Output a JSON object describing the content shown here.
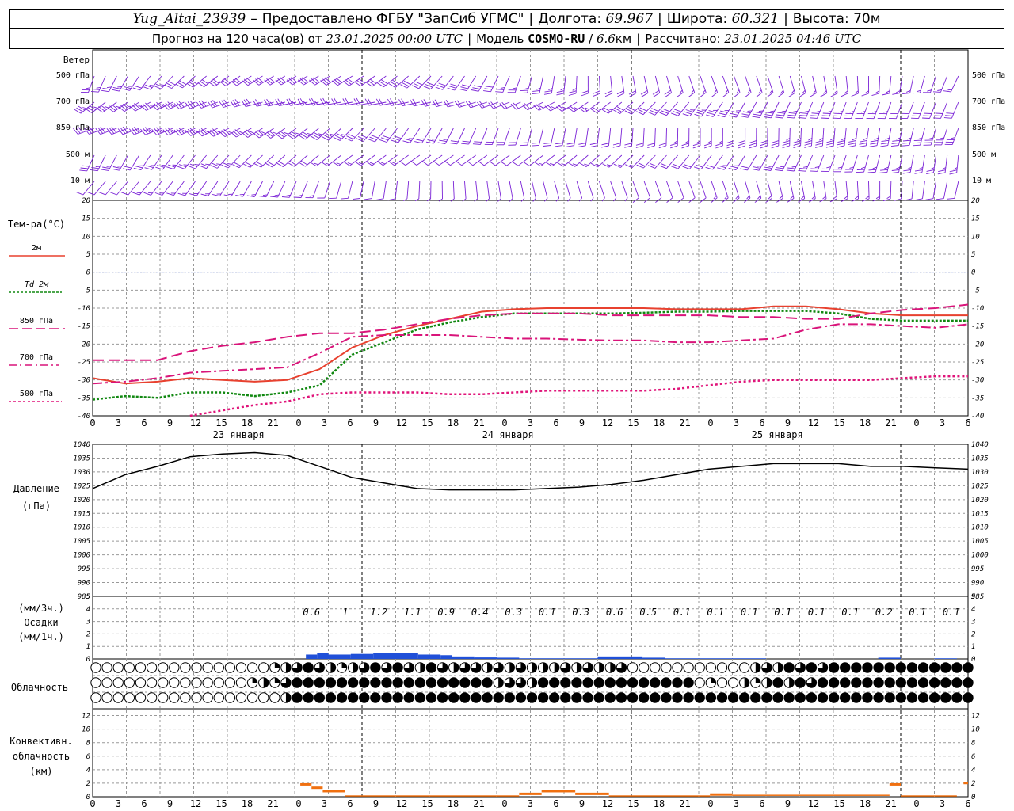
{
  "header": {
    "station": "Yug_Altai_23939",
    "dash": "–",
    "provided": "Предоставлено ФГБУ \"ЗапСиб УГМС\"",
    "lon_label": "Долгота:",
    "lon": "69.967",
    "lat_label": "Широта:",
    "lat": "60.321",
    "alt_label": "Высота:",
    "alt": "70м",
    "forecast_label": "Прогноз на 120 часа(ов) от",
    "forecast_start": "23.01.2025 00:00 UTC",
    "model_label": "Модель",
    "model": "COSMO-RU",
    "model_res_num": "6.6",
    "model_res_unit": "км",
    "calc_label": "Рассчитано:",
    "calc_time": "23.01.2025 04:46 UTC"
  },
  "labels": {
    "wind": "Ветер",
    "wind_levels": [
      "500 гПа",
      "700 гПа",
      "850 гПа",
      "500 м",
      "10  м"
    ],
    "temp_title": "Тем-ра(°С)",
    "temp_legend": [
      "2м",
      "Td  2м",
      "850 гПа",
      "700 гПа",
      "500 гПа"
    ],
    "pressure_title": "Давление",
    "pressure_unit": "(гПа)",
    "precip_unit1": "(мм/3ч.)",
    "precip_title": "Осадки",
    "precip_unit2": "(мм/1ч.)",
    "cloud_title": "Облачность",
    "conv_title1": "Конвективн.",
    "conv_title2": "облачность",
    "conv_unit": "(км)"
  },
  "chart_data": {
    "type": "line",
    "x_hours": [
      0,
      3,
      6,
      9,
      12,
      15,
      18,
      21,
      24,
      27,
      30,
      33,
      36,
      39,
      42,
      45,
      48,
      51,
      54,
      57,
      60,
      63,
      66,
      69,
      72,
      75,
      78,
      81,
      84,
      87,
      90,
      93,
      96,
      99,
      102,
      105,
      108,
      111,
      114,
      117,
      120
    ],
    "x_tick_labels": [
      "0",
      "3",
      "6",
      "9",
      "12",
      "15",
      "18",
      "21",
      "0",
      "3",
      "6",
      "9",
      "12",
      "15",
      "18",
      "21",
      "0",
      "3",
      "6",
      "9",
      "12",
      "15",
      "18",
      "21",
      "0",
      "3",
      "6",
      "9",
      "12",
      "15",
      "18",
      "21",
      "0",
      "3",
      "6"
    ],
    "date_labels": [
      {
        "text": "23 января",
        "hour": 13
      },
      {
        "text": "24 января",
        "hour": 37
      },
      {
        "text": "25 января",
        "hour": 61
      }
    ],
    "temperature": {
      "ylim": [
        -40,
        20
      ],
      "yticks": [
        20,
        15,
        10,
        5,
        0,
        -5,
        -10,
        -15,
        -20,
        -25,
        -30,
        -35,
        -40
      ],
      "series": [
        {
          "name": "2м",
          "color": "#e8412f",
          "values": [
            -29.5,
            -31,
            -30.5,
            -29.5,
            -30,
            -30.5,
            -30,
            -27,
            -21,
            -17.5,
            -15,
            -13,
            -11,
            -10.3,
            -10,
            -10,
            -10,
            -10,
            -10.3,
            -10.3,
            -10.3,
            -9.5,
            -9.5,
            -10.3,
            -11.5,
            -12,
            -12,
            -12
          ]
        },
        {
          "name": "Td  2м",
          "color": "#118811",
          "values": [
            -35.5,
            -34.5,
            -35,
            -33.5,
            -33.5,
            -34.5,
            -33.5,
            -31.5,
            -23,
            -19.5,
            -16,
            -14,
            -12.5,
            -11.5,
            -11.5,
            -11.5,
            -11.5,
            -11.3,
            -11,
            -11,
            -10.8,
            -10.8,
            -10.8,
            -11.5,
            -13,
            -13.5,
            -13.5,
            -13.5
          ]
        },
        {
          "name": "850 гПа",
          "color": "#d9147a",
          "values": [
            -24.5,
            -24.5,
            -24.5,
            -22,
            -20.5,
            -19.5,
            -18,
            -17,
            -17,
            -16,
            -14.5,
            -13,
            -12,
            -11.5,
            -11.5,
            -11.5,
            -12,
            -12,
            -12,
            -12,
            -12.5,
            -12.5,
            -13,
            -13,
            -11.5,
            -10.5,
            -10,
            -9
          ]
        },
        {
          "name": "700 гПа",
          "color": "#d9147a",
          "values": [
            -31,
            -30.5,
            -29.5,
            -28,
            -27.5,
            -27,
            -26.5,
            -22.5,
            -18,
            -17.5,
            -17.5,
            -17.5,
            -18,
            -18.5,
            -18.5,
            -18.8,
            -19,
            -19,
            -19.5,
            -19.5,
            -19,
            -18.5,
            -16,
            -14.5,
            -14.5,
            -15,
            -15.5,
            -14.5
          ]
        },
        {
          "name": "500 гПа",
          "color": "#e0147a",
          "values": [
            null,
            null,
            null,
            -40,
            -38.5,
            -37,
            -36,
            -34,
            -33.5,
            -33.5,
            -33.5,
            -34,
            -34,
            -33.5,
            -33,
            -33,
            -33,
            -33,
            -32.5,
            -31.5,
            -30.5,
            -30,
            -30,
            -30,
            -30,
            -29.5,
            -29,
            -29
          ]
        }
      ]
    },
    "pressure": {
      "ylim": [
        985,
        1040
      ],
      "yticks": [
        1040,
        1035,
        1030,
        1025,
        1020,
        1015,
        1010,
        1005,
        1000,
        995,
        990,
        985
      ],
      "values": [
        1024,
        1029,
        1032,
        1035.5,
        1036.5,
        1037,
        1036,
        1032,
        1028,
        1026,
        1024,
        1023.5,
        1023.5,
        1023.5,
        1024,
        1024.5,
        1025.5,
        1027,
        1029,
        1031,
        1032,
        1033,
        1033,
        1033,
        1032,
        1032,
        1031.5,
        1031
      ]
    },
    "precip_3h": {
      "ylim": [
        0,
        5
      ],
      "yticks": [
        5,
        4,
        3,
        2,
        1,
        0
      ],
      "labels": [
        {
          "hour": 19.5,
          "text": "0.6"
        },
        {
          "hour": 22.5,
          "text": "1"
        },
        {
          "hour": 25.5,
          "text": "1.2"
        },
        {
          "hour": 28.5,
          "text": "1.1"
        },
        {
          "hour": 31.5,
          "text": "0.9"
        },
        {
          "hour": 34.5,
          "text": "0.4"
        },
        {
          "hour": 37.5,
          "text": "0.3"
        },
        {
          "hour": 40.5,
          "text": "0.1"
        },
        {
          "hour": 43.5,
          "text": "0.3"
        },
        {
          "hour": 46.5,
          "text": "0.6"
        },
        {
          "hour": 49.5,
          "text": "0.5"
        },
        {
          "hour": 52.5,
          "text": "0.1"
        },
        {
          "hour": 55.5,
          "text": "0.1"
        },
        {
          "hour": 58.5,
          "text": "0.1"
        },
        {
          "hour": 61.5,
          "text": "0.1"
        },
        {
          "hour": 64.5,
          "text": "0.1"
        },
        {
          "hour": 67.5,
          "text": "0.1"
        },
        {
          "hour": 70.5,
          "text": "0.2"
        },
        {
          "hour": 73.5,
          "text": "0.1"
        },
        {
          "hour": 76.5,
          "text": "0.1"
        }
      ],
      "hourly_bars": [
        {
          "start": 19,
          "end": 20,
          "value": 0.35
        },
        {
          "start": 20,
          "end": 21,
          "value": 0.5
        },
        {
          "start": 21,
          "end": 23,
          "value": 0.35
        },
        {
          "start": 23,
          "end": 25,
          "value": 0.4
        },
        {
          "start": 25,
          "end": 27,
          "value": 0.45
        },
        {
          "start": 27,
          "end": 29,
          "value": 0.45
        },
        {
          "start": 29,
          "end": 31,
          "value": 0.35
        },
        {
          "start": 31,
          "end": 32,
          "value": 0.3
        },
        {
          "start": 32,
          "end": 34,
          "value": 0.2
        },
        {
          "start": 34,
          "end": 36,
          "value": 0.12
        },
        {
          "start": 36,
          "end": 38,
          "value": 0.1
        },
        {
          "start": 38,
          "end": 45,
          "value": 0.05
        },
        {
          "start": 45,
          "end": 49,
          "value": 0.2
        },
        {
          "start": 49,
          "end": 51,
          "value": 0.1
        },
        {
          "start": 51,
          "end": 60,
          "value": 0.05
        },
        {
          "start": 70,
          "end": 72,
          "value": 0.1
        },
        {
          "start": 75,
          "end": 77,
          "value": 0.05
        }
      ]
    },
    "clouds": {
      "note_levels": [
        "high",
        "middle",
        "low"
      ],
      "hours": [
        0,
        1,
        2,
        3,
        4,
        5,
        6,
        7,
        8,
        9,
        10,
        11,
        12,
        13,
        14,
        15,
        16,
        17,
        18,
        19,
        20,
        21,
        22,
        23,
        24,
        25,
        26,
        27,
        28,
        29,
        30,
        31,
        32,
        33,
        34,
        35,
        36,
        37,
        38,
        39,
        40,
        41,
        42,
        43,
        44,
        45,
        46,
        47,
        48,
        49,
        50,
        51,
        52,
        53,
        54,
        55,
        56,
        57,
        58,
        59,
        60,
        61,
        62,
        63,
        64,
        65,
        66,
        67,
        68,
        69,
        70,
        71,
        72,
        73,
        74,
        75,
        76,
        77,
        78
      ],
      "high": [
        0,
        0,
        0,
        0,
        0,
        0,
        0,
        0,
        0,
        0,
        0,
        0,
        0,
        0,
        0,
        0,
        1,
        2,
        3,
        4,
        3,
        2,
        1,
        2,
        3,
        4,
        3,
        4,
        3,
        2,
        4,
        3,
        2,
        3,
        3,
        2,
        3,
        2,
        3,
        2,
        2,
        2,
        3,
        2,
        3,
        2,
        2,
        3,
        0,
        0,
        0,
        0,
        0,
        0,
        0,
        0,
        0,
        0,
        0,
        2,
        3,
        2,
        4,
        3,
        4,
        3,
        4,
        4,
        4,
        4,
        4,
        4,
        4,
        4,
        4,
        4,
        4,
        4,
        4
      ],
      "middle": [
        0,
        0,
        0,
        0,
        0,
        0,
        0,
        0,
        0,
        0,
        0,
        0,
        0,
        0,
        1,
        2,
        1,
        3,
        4,
        4,
        4,
        4,
        4,
        4,
        4,
        4,
        4,
        4,
        4,
        4,
        4,
        4,
        4,
        4,
        4,
        4,
        2,
        3,
        3,
        2,
        4,
        4,
        4,
        4,
        4,
        4,
        4,
        4,
        4,
        4,
        4,
        4,
        4,
        4,
        0,
        1,
        0,
        0,
        2,
        1,
        2,
        4,
        2,
        4,
        3,
        4,
        4,
        4,
        4,
        4,
        4,
        4,
        4,
        4,
        4,
        4,
        4,
        4,
        4
      ],
      "low": [
        0,
        0,
        0,
        0,
        0,
        0,
        0,
        0,
        0,
        0,
        0,
        0,
        0,
        0,
        0,
        0,
        0,
        2,
        4,
        4,
        4,
        4,
        4,
        4,
        4,
        4,
        4,
        4,
        4,
        4,
        4,
        4,
        4,
        4,
        4,
        4,
        4,
        4,
        4,
        4,
        4,
        4,
        4,
        4,
        4,
        4,
        4,
        4,
        4,
        4,
        4,
        4,
        4,
        4,
        4,
        4,
        4,
        4,
        4,
        4,
        4,
        4,
        4,
        4,
        4,
        4,
        4,
        4,
        4,
        4,
        4,
        4,
        4,
        4,
        4,
        4,
        4,
        4,
        4
      ]
    },
    "convective": {
      "ylim": [
        0,
        13
      ],
      "yticks": [
        12,
        10,
        8,
        6,
        4,
        2,
        0
      ],
      "segments": [
        {
          "start": 18.5,
          "end": 19.5,
          "top": 2.0
        },
        {
          "start": 19.5,
          "end": 20.5,
          "top": 1.5
        },
        {
          "start": 20.5,
          "end": 22.5,
          "top": 1.0
        },
        {
          "start": 22.5,
          "end": 38,
          "top": 0.2
        },
        {
          "start": 38,
          "end": 40,
          "top": 0.6
        },
        {
          "start": 40,
          "end": 43,
          "top": 1.0
        },
        {
          "start": 43,
          "end": 46,
          "top": 0.6
        },
        {
          "start": 46,
          "end": 55,
          "top": 0.2
        },
        {
          "start": 55,
          "end": 57,
          "top": 0.5
        },
        {
          "start": 57,
          "end": 71,
          "top": 0.3
        },
        {
          "start": 71,
          "end": 72,
          "top": 2.0
        },
        {
          "start": 72,
          "end": 77,
          "top": 0.2
        },
        {
          "start": 77.6,
          "end": 78,
          "top": 2.2
        }
      ]
    },
    "wind_barb_color": "#7a22d6",
    "colors": {
      "grid": "#999999",
      "zero_line": "#2244cc",
      "precip": "#2050d8",
      "convective": "#f07010",
      "pressure": "#000000"
    }
  }
}
